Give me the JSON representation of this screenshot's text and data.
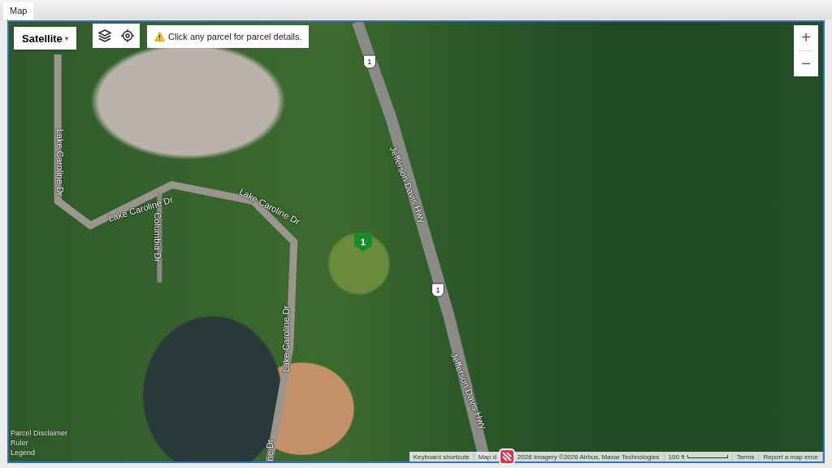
{
  "tabs": [
    {
      "label": "Map",
      "selected": true
    }
  ],
  "map": {
    "type_control": {
      "value": "Satellite",
      "caret": "▾"
    },
    "notice": "Click any parcel for parcel details.",
    "zoom": {
      "plus": "+",
      "minus": "−"
    },
    "road_labels": [
      "Lake Caroline Dr",
      "Lake Caroline Dr",
      "Columbia Dr",
      "Lake Caroline Dr",
      "Lake Caroline Dr",
      "ne Dr",
      "Jefferson Davis Hwy",
      "Jefferson Davis Hwy"
    ],
    "route_shields": [
      "1",
      "1"
    ],
    "pin": {
      "text": "1",
      "color": "#1b8a2a"
    },
    "left_links": [
      "Parcel Disclaimer",
      "Ruler",
      "Legend"
    ],
    "attribution": [
      "Keyboard shortcuts",
      "Map d",
      "2026 Imagery ©2026 Airbus, Maxar Technologies",
      "100 ft",
      "Terms",
      "Report a map error"
    ]
  }
}
